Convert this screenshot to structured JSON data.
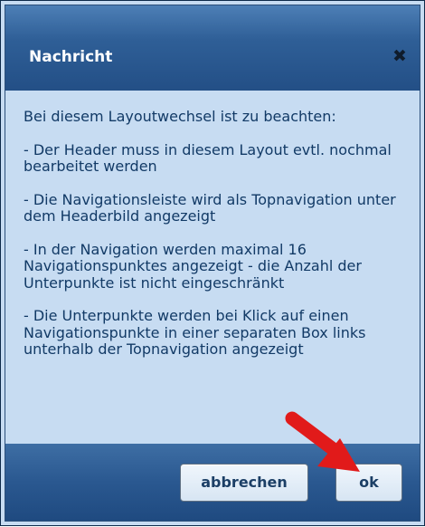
{
  "dialog": {
    "title": "Nachricht",
    "close_symbol": "✖",
    "paragraphs": [
      "Bei diesem Layoutwechsel ist zu beachten:",
      "- Der Header muss in diesem Layout evtl. nochmal bearbeitet werden",
      "- Die Navigationsleiste wird als Topnavigation unter dem Headerbild angezeigt",
      "- In der Navigation werden maximal 16 Navigationspunktes angezeigt - die Anzahl der Unterpunkte ist nicht eingeschränkt",
      "- Die Unterpunkte werden bei Klick auf einen Navigationspunkte in einer separaten Box links unterhalb der Topnavigation angezeigt"
    ],
    "buttons": {
      "cancel_label": "abbrechen",
      "ok_label": "ok"
    }
  },
  "colors": {
    "background": "#c7dcf2",
    "titlebar": "#2f5f97",
    "text": "#123a66",
    "arrow": "#e11a1a"
  },
  "icons": {
    "close": "close-icon",
    "pointer": "red-arrow-annotation"
  }
}
